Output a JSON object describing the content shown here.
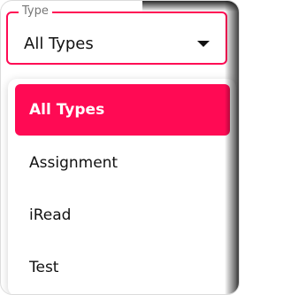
{
  "select": {
    "label": "Type",
    "value": "All Types",
    "icon": "caret-down-icon"
  },
  "menu": {
    "options": [
      {
        "label": "All Types",
        "selected": true
      },
      {
        "label": "Assignment",
        "selected": false
      },
      {
        "label": "iRead",
        "selected": false
      },
      {
        "label": "Test",
        "selected": false
      }
    ]
  },
  "colors": {
    "accent": "#ff0a54",
    "text": "#111111",
    "label": "#777777"
  }
}
